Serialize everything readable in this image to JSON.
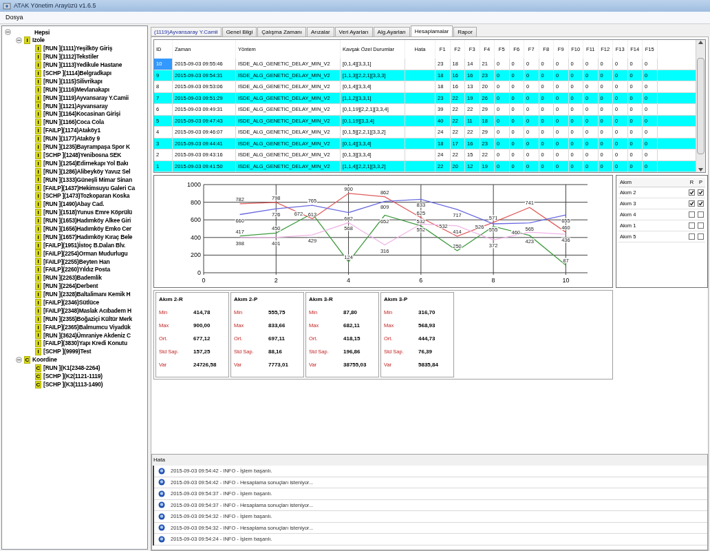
{
  "window": {
    "title": "ATAK Yönetim Arayüzü v1.6.5"
  },
  "menu": [
    "Dosya"
  ],
  "tree": {
    "label": "Hepsi",
    "expanded": true,
    "children": [
      {
        "label": "Izole",
        "badge": "I",
        "expanded": true,
        "children": [
          {
            "label": "[RUN  ](1111)Yeşilköy Giriş",
            "badge": "I"
          },
          {
            "label": "[RUN  ](1112)Tekstiler",
            "badge": "I"
          },
          {
            "label": "[RUN  ](1113)Yedikule Hastane",
            "badge": "I"
          },
          {
            "label": "[SCHP ](1114)Belgradkapı",
            "badge": "I"
          },
          {
            "label": "[RUN  ](1115)Silivrikapı",
            "badge": "I"
          },
          {
            "label": "[RUN  ](1116)Mevlanakapı",
            "badge": "I"
          },
          {
            "label": "[RUN  ](1119)Ayvansaray Y.Camii",
            "badge": "I"
          },
          {
            "label": "[RUN  ](1121)Ayvansaray",
            "badge": "I"
          },
          {
            "label": "[RUN  ](1164)Kocasinan Girişi",
            "badge": "I"
          },
          {
            "label": "[RUN  ](1166)Coca Cola",
            "badge": "I"
          },
          {
            "label": "[FAILP](1174)Ataköy1",
            "badge": "I"
          },
          {
            "label": "[RUN  ](1177)Ataköy 9",
            "badge": "I"
          },
          {
            "label": "[RUN  ](1235)Bayrampaşa Spor K",
            "badge": "I"
          },
          {
            "label": "[SCHP ](1248)Yenibosna SEK",
            "badge": "I"
          },
          {
            "label": "[RUN  ](1254)Edirnekapı Yol Bakı",
            "badge": "I"
          },
          {
            "label": "[RUN  ](1286)Alibeyköy Yavuz Sel",
            "badge": "I"
          },
          {
            "label": "[RUN  ](1333)Güneşli Mimar Sinan",
            "badge": "I"
          },
          {
            "label": "[FAILP](1437)Hekimsuyu Galeri Ca",
            "badge": "I"
          },
          {
            "label": "[SCHP ](1473)Tozkoparan Koska",
            "badge": "I"
          },
          {
            "label": "[RUN  ](1490)Abay Cad.",
            "badge": "I"
          },
          {
            "label": "[RUN  ](1518)Yunus Emre Köprülü",
            "badge": "I"
          },
          {
            "label": "[RUN  ](1653)Hadımköy Alkee Giri",
            "badge": "I"
          },
          {
            "label": "[RUN  ](1656)Hadımköy Emko Cer",
            "badge": "I"
          },
          {
            "label": "[RUN  ](1657)Hadımköy Kıraç Bele",
            "badge": "I"
          },
          {
            "label": "[FAILP](1951)İstoç B.Dalan Blv.",
            "badge": "I"
          },
          {
            "label": "[FAILP](2254)Orman Mudurlugu",
            "badge": "I"
          },
          {
            "label": "[FAILP](2255)Beyten Han",
            "badge": "I"
          },
          {
            "label": "[FAILP](2260)Yıldız Posta",
            "badge": "I"
          },
          {
            "label": "[RUN  ](2263)Bademlik",
            "badge": "I"
          },
          {
            "label": "[RUN  ](2264)Derbent",
            "badge": "I"
          },
          {
            "label": "[RUN  ](2328)Baltalimanı Kemik H",
            "badge": "I"
          },
          {
            "label": "[FAILP](2346)Sütlüce",
            "badge": "I"
          },
          {
            "label": "[FAILP](2348)Maslak Acıbadem H",
            "badge": "I"
          },
          {
            "label": "[RUN  ](2355)Boğaziçi Kültür Merk",
            "badge": "I"
          },
          {
            "label": "[FAILP](2365)Balmumcu Viyadük",
            "badge": "I"
          },
          {
            "label": "[RUN  ](3624)Ümraniye Akdeniz C",
            "badge": "I"
          },
          {
            "label": "[FAILP](3830)Yapı Kredi Konutu",
            "badge": "I"
          },
          {
            "label": "[SCHP ](9999)Test",
            "badge": "I"
          }
        ]
      },
      {
        "label": "Koordine",
        "badge": "C",
        "expanded": true,
        "children": [
          {
            "label": "[RUN  ](K1(2348-2264)",
            "badge": "C"
          },
          {
            "label": "[SCHP ](K2(1121-1119)",
            "badge": "C"
          },
          {
            "label": "[SCHP ](K3(1113-1490)",
            "badge": "C"
          }
        ]
      }
    ]
  },
  "intersection_label": "(1119)Ayvansaray Y.Camii",
  "tabs": [
    {
      "label": "Genel Bilgi",
      "selected": false
    },
    {
      "label": "Çalışma Zamanı",
      "selected": false
    },
    {
      "label": "Arızalar",
      "selected": false
    },
    {
      "label": "Veri Ayarları",
      "selected": false
    },
    {
      "label": "Alg.Ayarları",
      "selected": false
    },
    {
      "label": "Hesaplamalar",
      "selected": true
    },
    {
      "label": "Rapor",
      "selected": false
    }
  ],
  "table": {
    "columns": [
      "ID",
      "Zaman",
      "Yöntem",
      "Kavşak Özel Durumlar",
      "Hata",
      "F1",
      "F2",
      "F3",
      "F4",
      "F5",
      "F6",
      "F7",
      "F8",
      "F9",
      "F10",
      "F11",
      "F12",
      "F13",
      "F14",
      "F15"
    ],
    "rows": [
      {
        "selected": true,
        "cells": [
          "10",
          "2015-09-03 09:55:46",
          "ISDE_ALG_GENETIC_DELAY_MIN_V2",
          "[0,1,4][3,3,1]",
          "",
          "23",
          "18",
          "14",
          "21",
          "0",
          "0",
          "0",
          "0",
          "0",
          "0",
          "0",
          "0",
          "0",
          "0",
          "0"
        ]
      },
      {
        "selected": false,
        "cells": [
          "9",
          "2015-09-03 09:54:31",
          "ISDE_ALG_GENETIC_DELAY_MIN_V2",
          "[1,1,3][2,2,1][3,3,3]",
          "",
          "18",
          "16",
          "16",
          "23",
          "0",
          "0",
          "0",
          "0",
          "0",
          "0",
          "0",
          "0",
          "0",
          "0",
          "0"
        ]
      },
      {
        "selected": false,
        "cells": [
          "8",
          "2015-09-03 09:53:06",
          "ISDE_ALG_GENETIC_DELAY_MIN_V2",
          "[0,1,4][3,3,4]",
          "",
          "18",
          "16",
          "13",
          "20",
          "0",
          "0",
          "0",
          "0",
          "0",
          "0",
          "0",
          "0",
          "0",
          "0",
          "0"
        ]
      },
      {
        "selected": false,
        "cells": [
          "7",
          "2015-09-03 09:51:29",
          "ISDE_ALG_GENETIC_DELAY_MIN_V2",
          "[1,1,2][3,3,1]",
          "",
          "23",
          "22",
          "19",
          "26",
          "0",
          "0",
          "0",
          "0",
          "0",
          "0",
          "0",
          "0",
          "0",
          "0",
          "0"
        ]
      },
      {
        "selected": false,
        "cells": [
          "6",
          "2015-09-03 09:49:31",
          "ISDE_ALG_GENETIC_DELAY_MIN_V2",
          "[0,1,19][2,2,1][3,3,4]",
          "",
          "39",
          "22",
          "22",
          "29",
          "0",
          "0",
          "0",
          "0",
          "0",
          "0",
          "0",
          "0",
          "0",
          "0",
          "0"
        ]
      },
      {
        "selected": false,
        "cells": [
          "5",
          "2015-09-03 09:47:43",
          "ISDE_ALG_GENETIC_DELAY_MIN_V2",
          "[0,1,19][3,3,4]",
          "",
          "40",
          "22",
          "11",
          "18",
          "0",
          "0",
          "0",
          "0",
          "0",
          "0",
          "0",
          "0",
          "0",
          "0",
          "0"
        ]
      },
      {
        "selected": false,
        "cells": [
          "4",
          "2015-09-03 09:46:07",
          "ISDE_ALG_GENETIC_DELAY_MIN_V2",
          "[0,1,5][2,2,1][3,3,2]",
          "",
          "24",
          "22",
          "22",
          "29",
          "0",
          "0",
          "0",
          "0",
          "0",
          "0",
          "0",
          "0",
          "0",
          "0",
          "0"
        ]
      },
      {
        "selected": false,
        "cells": [
          "3",
          "2015-09-03 09:44:41",
          "ISDE_ALG_GENETIC_DELAY_MIN_V2",
          "[0,1,4][3,3,4]",
          "",
          "18",
          "17",
          "16",
          "23",
          "0",
          "0",
          "0",
          "0",
          "0",
          "0",
          "0",
          "0",
          "0",
          "0",
          "0"
        ]
      },
      {
        "selected": false,
        "cells": [
          "2",
          "2015-09-03 09:43:16",
          "ISDE_ALG_GENETIC_DELAY_MIN_V2",
          "[0,1,3][3,3,4]",
          "",
          "24",
          "22",
          "15",
          "22",
          "0",
          "0",
          "0",
          "0",
          "0",
          "0",
          "0",
          "0",
          "0",
          "0",
          "0"
        ]
      },
      {
        "selected": false,
        "cells": [
          "1",
          "2015-09-03 09:41:50",
          "ISDE_ALG_GENETIC_DELAY_MIN_V2",
          "[1,1,4][2,2,1][3,3,2]",
          "",
          "22",
          "20",
          "12",
          "19",
          "0",
          "0",
          "0",
          "0",
          "0",
          "0",
          "0",
          "0",
          "0",
          "0",
          "0"
        ]
      }
    ]
  },
  "chart_data": {
    "type": "line",
    "grid": true,
    "x": [
      1,
      2,
      3,
      4,
      5,
      6,
      7,
      8,
      9,
      10
    ],
    "xlim": [
      0,
      10.6
    ],
    "ylim": [
      0,
      1000
    ],
    "xticks": [
      0,
      2,
      4,
      6,
      8,
      10
    ],
    "yticks": [
      0,
      200,
      400,
      600,
      800,
      1000
    ],
    "data_labels": true,
    "series": [
      {
        "color": "#e05a5a",
        "values": [
          782,
          798,
          613,
          900,
          862,
          625,
          414,
          571,
          741,
          460
        ]
      },
      {
        "color": "#6a6ae0",
        "values": [
          660,
          726,
          765,
          682,
          809,
          833,
          717,
          555,
          565,
          655
        ]
      },
      {
        "color": "#3f9a3f",
        "values": [
          417,
          450,
          672,
          124,
          652,
          532,
          250,
          526,
          423,
          87
        ]
      },
      {
        "color": "#f0b4e6",
        "values": [
          398,
          401,
          429,
          568,
          316,
          552,
          532,
          372,
          460,
          436
        ]
      }
    ]
  },
  "legend_table": {
    "columns": [
      "Akım",
      "R",
      "P"
    ],
    "rows": [
      {
        "label": "Akım 2",
        "r_checked": true,
        "p_checked": true
      },
      {
        "label": "Akım 3",
        "r_checked": true,
        "p_checked": true
      },
      {
        "label": "Akım 4",
        "r_checked": false,
        "p_checked": false
      },
      {
        "label": "Akım 1",
        "r_checked": false,
        "p_checked": false
      },
      {
        "label": "Akım 5",
        "r_checked": false,
        "p_checked": false
      }
    ]
  },
  "stats": [
    {
      "title": "Akım 2-R",
      "rows": [
        [
          "Min",
          "414,78"
        ],
        [
          "Max",
          "900,00"
        ],
        [
          "Ort.",
          "677,12"
        ],
        [
          "Std Sap.",
          "157,25"
        ],
        [
          "Var",
          "24726,58"
        ]
      ]
    },
    {
      "title": "Akım 2-P",
      "rows": [
        [
          "Min",
          "555,75"
        ],
        [
          "Max",
          "833,66"
        ],
        [
          "Ort.",
          "697,11"
        ],
        [
          "Std Sap.",
          "88,16"
        ],
        [
          "Var",
          "7773,01"
        ]
      ]
    },
    {
      "title": "Akım 3-R",
      "rows": [
        [
          "Min",
          "87,80"
        ],
        [
          "Max",
          "682,11"
        ],
        [
          "Ort.",
          "418,15"
        ],
        [
          "Std Sap.",
          "196,86"
        ],
        [
          "Var",
          "38755,03"
        ]
      ]
    },
    {
      "title": "Akım 3-P",
      "rows": [
        [
          "Min",
          "316,70"
        ],
        [
          "Max",
          "568,93"
        ],
        [
          "Ort.",
          "444,73"
        ],
        [
          "Std Sap.",
          "76,39"
        ],
        [
          "Var",
          "5835,84"
        ]
      ]
    }
  ],
  "log": {
    "title": "Hata",
    "entries": [
      "2015-09-03 09:54:42 - INFO - İşlem başarılı.",
      "2015-09-03 09:54:42 - INFO - Hesaplama sonuçları isteniyor...",
      "2015-09-03 09:54:37 - INFO - İşlem başarılı.",
      "2015-09-03 09:54:37 - INFO - Hesaplama sonuçları isteniyor...",
      "2015-09-03 09:54:32 - INFO - İşlem başarılı.",
      "2015-09-03 09:54:32 - INFO - Hesaplama sonuçları isteniyor...",
      "2015-09-03 09:54:24 - INFO - İşlem başarılı."
    ]
  }
}
